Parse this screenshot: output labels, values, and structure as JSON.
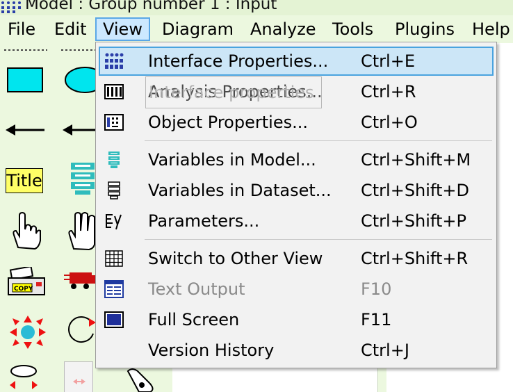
{
  "window": {
    "title": "Model : Group number 1 : Input",
    "title_icon": "amos-model-icon"
  },
  "menubar": {
    "items": [
      {
        "label": "File"
      },
      {
        "label": "Edit"
      },
      {
        "label": "View",
        "active": true
      },
      {
        "label": "Diagram"
      },
      {
        "label": "Analyze"
      },
      {
        "label": "Tools"
      },
      {
        "label": "Plugins"
      },
      {
        "label": "Help"
      }
    ]
  },
  "toolbox": {
    "title_tool_label": "Title"
  },
  "view_menu": {
    "items": [
      {
        "label": "Interface Properties...",
        "shortcut": "Ctrl+E",
        "icon": "interface-properties-icon",
        "highlighted": true
      },
      {
        "label": "Analysis Properties...",
        "shortcut": "Ctrl+R",
        "icon": "analysis-properties-icon"
      },
      {
        "label": "Object Properties...",
        "shortcut": "Ctrl+O",
        "icon": "object-properties-icon"
      },
      {
        "label": "Variables in Model...",
        "shortcut": "Ctrl+Shift+M",
        "icon": "variables-in-model-icon"
      },
      {
        "label": "Variables in Dataset...",
        "shortcut": "Ctrl+Shift+D",
        "icon": "variables-in-dataset-icon"
      },
      {
        "label": "Parameters...",
        "shortcut": "Ctrl+Shift+P",
        "icon": "parameters-icon"
      },
      {
        "label": "Switch to Other View",
        "shortcut": "Ctrl+Shift+R",
        "icon": "switch-view-icon"
      },
      {
        "label": "Text Output",
        "shortcut": "F10",
        "icon": "text-output-icon",
        "disabled": true
      },
      {
        "label": "Full Screen",
        "shortcut": "F11",
        "icon": "full-screen-icon"
      },
      {
        "label": "Version History",
        "shortcut": "Ctrl+J",
        "icon": ""
      }
    ],
    "tooltip_ghost": "Interface properties"
  },
  "colors": {
    "menubar_bg": "#ecf8df",
    "highlight_bg": "#cce6f7",
    "highlight_border": "#4aa3df",
    "tool_cyan": "#00e5ee"
  }
}
